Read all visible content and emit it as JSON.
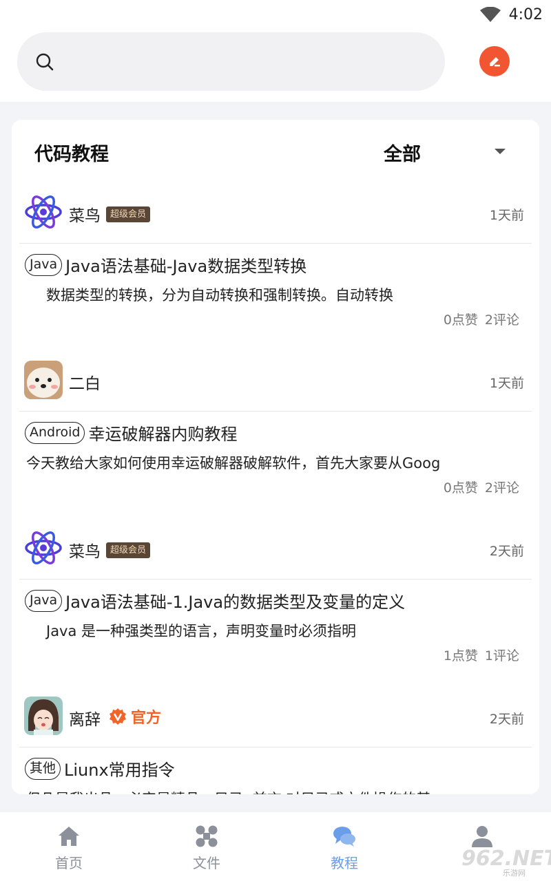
{
  "status": {
    "time": "4:02",
    "wifi_icon": "wifi-icon"
  },
  "search": {
    "placeholder": "",
    "icon": "search-icon"
  },
  "header": {
    "edit_icon": "edit-icon",
    "accent": "#f25532"
  },
  "section": {
    "title": "代码教程",
    "filter": "全部"
  },
  "posts": [
    {
      "user": "菜鸟",
      "badge": "超级会员",
      "time": "1天前",
      "tag": "Java",
      "title": "Java语法基础-Java数据类型转换",
      "summary": "数据类型的转换，分为自动转换和强制转换。自动转换",
      "likes": "0点赞",
      "comments": "2评论"
    },
    {
      "user": "二白",
      "badge": "",
      "time": "1天前",
      "tag": "Android",
      "title": "幸运破解器内购教程",
      "summary": "今天教给大家如何使用幸运破解器破解软件，首先大家要从Goog",
      "likes": "0点赞",
      "comments": "2评论"
    },
    {
      "user": "菜鸟",
      "badge": "超级会员",
      "time": "2天前",
      "tag": "Java",
      "title": "Java语法基础-1.Java的数据类型及变量的定义",
      "summary": "Java 是一种强类型的语言，声明变量时必须指明",
      "likes": "1点赞",
      "comments": "1评论"
    },
    {
      "user": "离辞",
      "badge": "官方",
      "time": "2天前",
      "tag": "其他",
      "title": "Liunx常用指令",
      "summary": "但凡是我出品，必定是精品。目录: 前言 对目录或文件操作的基",
      "likes": "",
      "comments": ""
    }
  ],
  "nav": [
    {
      "label": "首页",
      "icon": "home-icon"
    },
    {
      "label": "文件",
      "icon": "file-icon"
    },
    {
      "label": "教程",
      "icon": "tutorial-chat-icon"
    },
    {
      "label": "",
      "icon": "profile-icon"
    }
  ],
  "watermark": {
    "text": "962.NET",
    "sub": "乐游网"
  }
}
